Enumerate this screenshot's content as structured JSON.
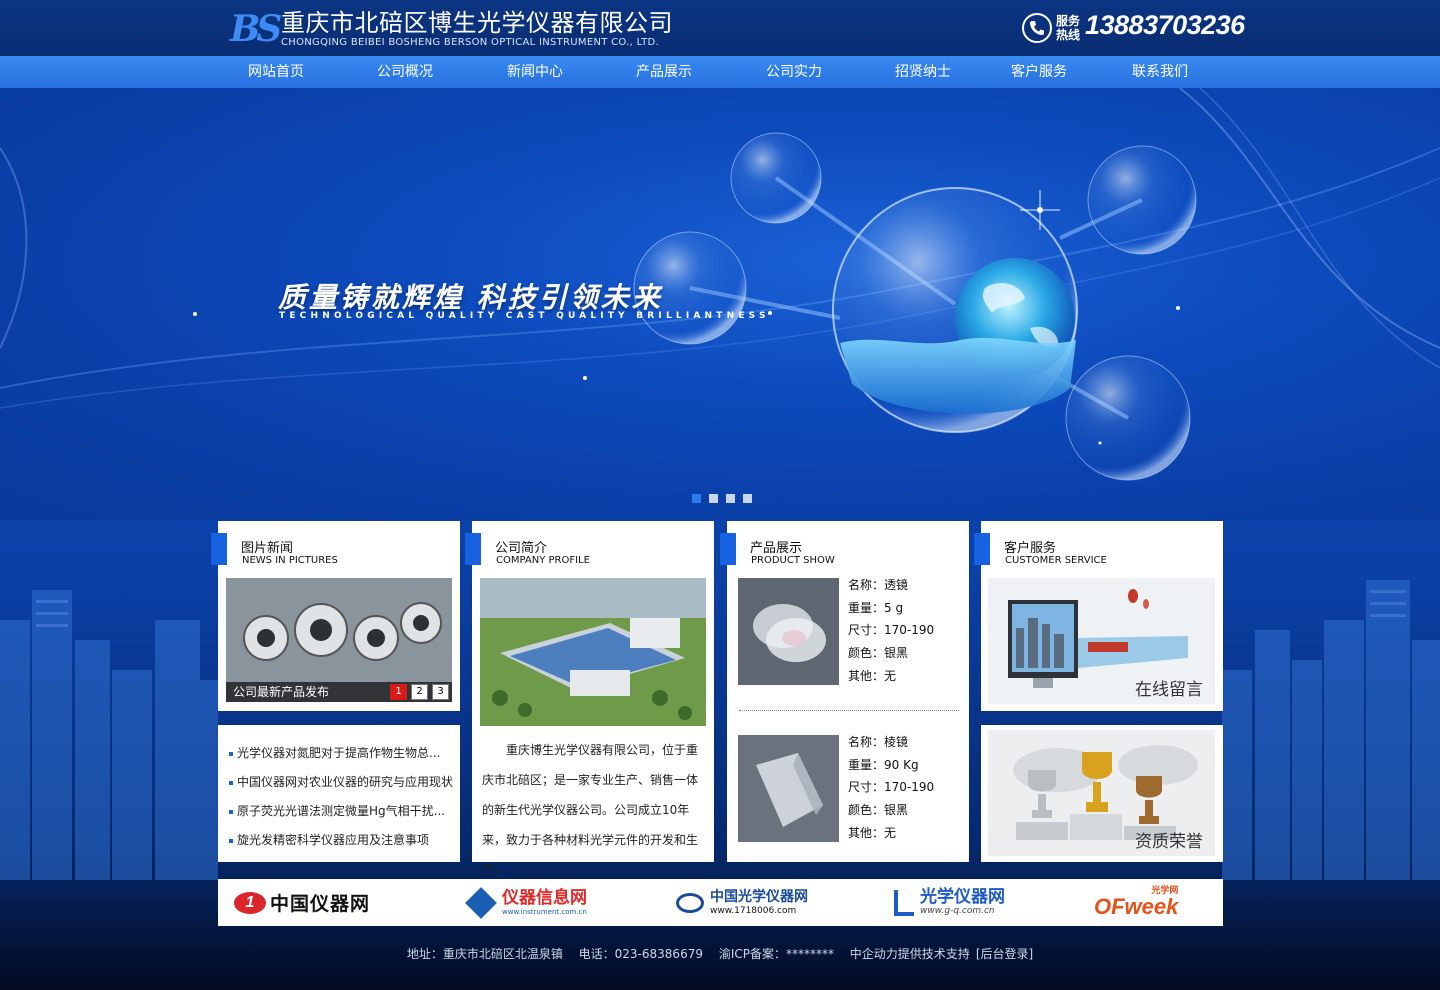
{
  "header": {
    "logo_mark": "BS",
    "company_cn": "重庆市北碚区博生光学仪器有限公司",
    "company_en": "CHONGQING BEIBEI BOSHENG BERSON OPTICAL INSTRUMENT CO., LTD.",
    "hotline_label": "服务热线",
    "hotline_number": "13883703236"
  },
  "nav": {
    "items": [
      {
        "label": "网站首页"
      },
      {
        "label": "公司概况"
      },
      {
        "label": "新闻中心"
      },
      {
        "label": "产品展示"
      },
      {
        "label": "公司实力"
      },
      {
        "label": "招贤纳士"
      },
      {
        "label": "客户服务"
      },
      {
        "label": "联系我们"
      }
    ]
  },
  "banner": {
    "slogan": "质量铸就辉煌   科技引领未来",
    "slogan_en": "TECHNOLOGICAL QUALITY CAST QUALITY BRILLIANTNESS",
    "slide_count": 4,
    "active_slide": 1
  },
  "news": {
    "title_cn": "图片新闻",
    "title_en": "NEWS IN PICTURES",
    "caption": "公司最新产品发布",
    "pages": [
      "1",
      "2",
      "3"
    ],
    "active_page": "1",
    "list": [
      "光学仪器对氮肥对于提高作物生物总...",
      "中国仪器网对农业仪器的研究与应用现状",
      "原子荧光光谱法测定微量Hg气相干扰...",
      "旋光发精密科学仪器应用及注意事项"
    ]
  },
  "profile": {
    "title_cn": "公司简介",
    "title_en": "COMPANY PROFILE",
    "text": "重庆博生光学仪器有限公司，位于重庆市北碚区；是一家专业生产、销售一体的新生代光学仪器公司。公司成立10年来，致力于各种材料光学元件的开发和生产。"
  },
  "products": {
    "title_cn": "产品展示",
    "title_en": "PRODUCT SHOW",
    "items": [
      {
        "name": "名称：透镜",
        "weight": "重量：5 g",
        "size": "尺寸：170-190",
        "color": "颜色：银黑",
        "other": "其他：无"
      },
      {
        "name": "名称：棱镜",
        "weight": "重量：90 Kg",
        "size": "尺寸：170-190",
        "color": "颜色：银黑",
        "other": "其他：无"
      }
    ]
  },
  "service": {
    "title_cn": "客户服务",
    "title_en": "CUSTOMER SERVICE",
    "online_message": "在线留言",
    "honors": "资质荣誉"
  },
  "links": [
    {
      "name": "中国仪器网"
    },
    {
      "name": "仪器信息网",
      "sub": "www.instrument.com.cn"
    },
    {
      "name": "中国光学仪器网",
      "sub": "www.1718006.com"
    },
    {
      "name": "光学仪器网",
      "sub": "www.g-q.com.cn"
    },
    {
      "name": "OFweek",
      "sub": "光学网"
    }
  ],
  "footer": {
    "address": "地址：重庆市北碚区北温泉镇",
    "phone": "电话：023-68386679",
    "icp": "渝ICP备案：********",
    "support": "中企动力提供技术支持",
    "admin": "[后台登录]"
  },
  "colors": {
    "accent": "#1662e0",
    "nav_bg": "#2f7de8",
    "header_bg": "#0b3583",
    "pager_active": "#d91a1a"
  }
}
